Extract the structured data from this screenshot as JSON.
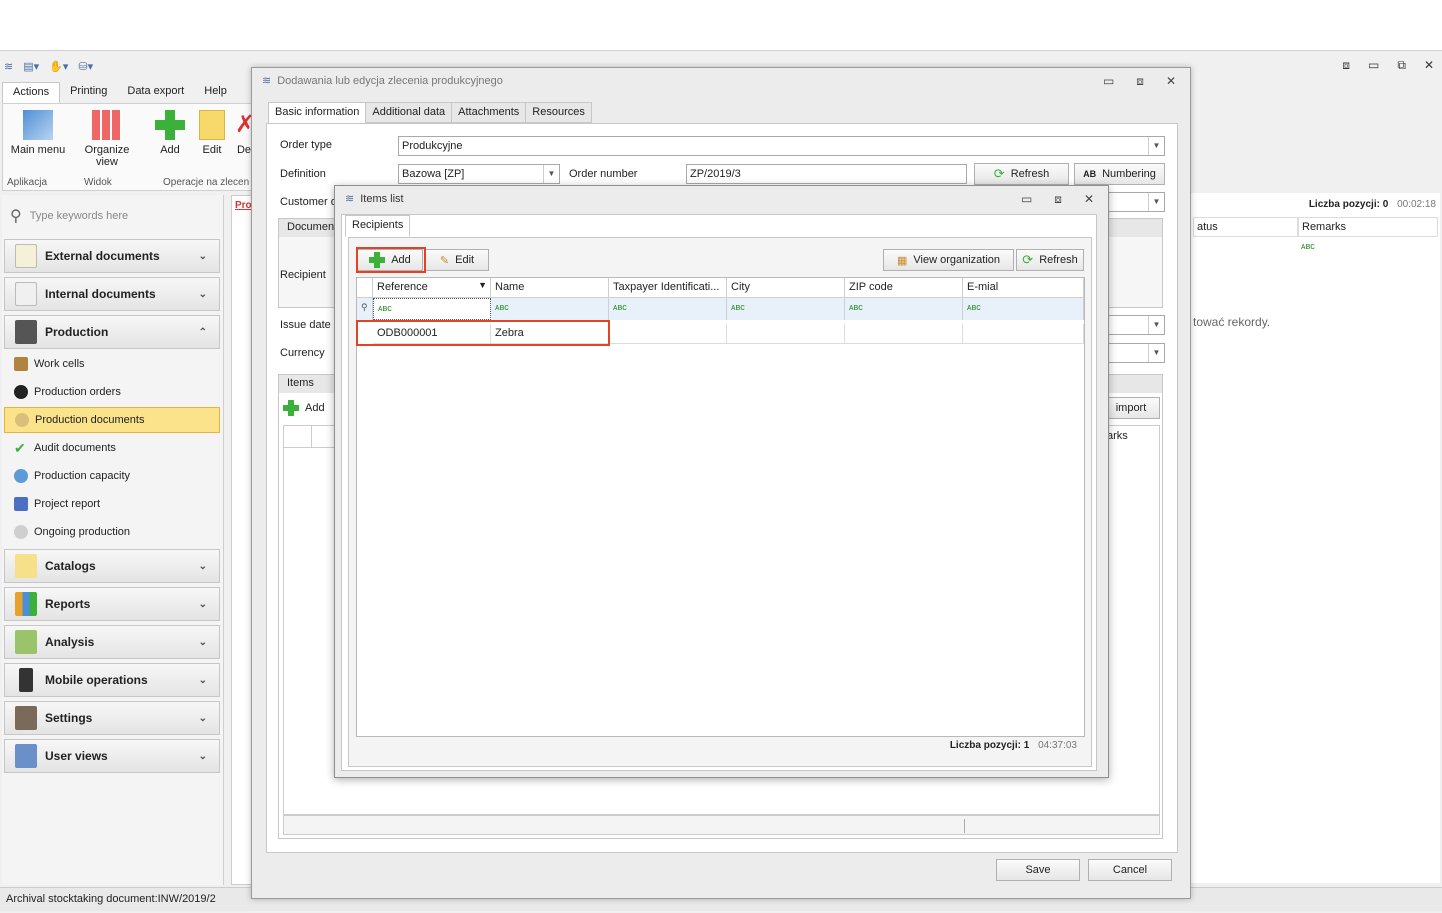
{
  "qat": {
    "icons": [
      "app-logo-icon",
      "layout-icon",
      "hand-icon",
      "db-icon"
    ]
  },
  "window_controls": [
    "⧈",
    "▭",
    "⧉",
    "✕"
  ],
  "ribbon": {
    "tabs": [
      "Actions",
      "Printing",
      "Data export",
      "Help"
    ],
    "buttons": {
      "main_menu": "Main menu",
      "organize_view": "Organize view",
      "add": "Add",
      "edit": "Edit",
      "de": "De"
    },
    "groups": {
      "aplikacja": "Aplikacja",
      "widok": "Widok",
      "operacje": "Operacje na zlecen"
    }
  },
  "sidebar": {
    "search_placeholder": "Type keywords here",
    "sections": {
      "external": "External documents",
      "internal": "Internal documents",
      "production": "Production",
      "catalogs": "Catalogs",
      "reports": "Reports",
      "analysis": "Analysis",
      "mobile": "Mobile operations",
      "settings": "Settings",
      "user_views": "User views"
    },
    "production_items": [
      "Work cells",
      "Production orders",
      "Production documents",
      "Audit documents",
      "Production capacity",
      "Project report",
      "Ongoing production"
    ]
  },
  "background": {
    "count_label": "Liczba pozycji: 0",
    "count_time": "00:02:18",
    "col_status": "atus",
    "col_remarks": "Remarks",
    "empty_text": "tować rekordy.",
    "pro_tab": "Pro"
  },
  "statusbar": {
    "text": "Archival stocktaking document:INW/2019/2"
  },
  "dialog": {
    "title": "Dodawania lub edycja zlecenia produkcyjnego",
    "tabs": [
      "Basic information",
      "Additional data",
      "Attachments",
      "Resources"
    ],
    "order_type_label": "Order type",
    "order_type_value": "Produkcyjne",
    "definition_label": "Definition",
    "definition_value": "Bazowa [ZP]",
    "order_number_label": "Order number",
    "order_number_value": "ZP/2019/3",
    "refresh": "Refresh",
    "numbering": "Numbering",
    "customer_label": "Customer o",
    "document_group": "Document",
    "recipient_label": "Recipient",
    "issue_date_label": "Issue date",
    "currency_label": "Currency",
    "items_group": "Items",
    "items_add": "Add",
    "import": "import",
    "arks": "arks",
    "save": "Save",
    "cancel": "Cancel"
  },
  "items_list": {
    "title": "Items list",
    "tab": "Recipients",
    "add": "Add",
    "edit": "Edit",
    "view_org": "View organization",
    "refresh": "Refresh",
    "columns": [
      "Reference",
      "Name",
      "Taxpayer Identificati...",
      "City",
      "ZIP code",
      "E-mial"
    ],
    "filter_glyph": "ᴀʙᴄ",
    "rows": [
      [
        "ODB000001",
        "Zebra",
        "",
        "",
        "",
        ""
      ]
    ],
    "count_label": "Liczba pozycji: 1",
    "count_time": "04:37:03"
  },
  "colors": {
    "highlight": "#e34224",
    "selected_nav": "#fbe38b",
    "accent_green": "#3bb03b"
  }
}
